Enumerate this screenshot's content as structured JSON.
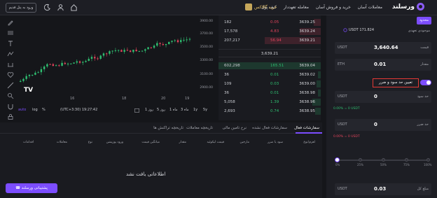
{
  "nav": {
    "brand": "ورسلند",
    "links": [
      "معاملات آسان",
      "خرید و فروش آسان",
      "معامله تعهددار",
      "کیف پول"
    ],
    "buy_link": "خرید گالاکس",
    "login_button": "ورود به پنل قدیم",
    "icons": [
      "home-icon",
      "user-icon",
      "moon-icon"
    ]
  },
  "chart": {
    "price_ticks": [
      "3900.00",
      "3700.00",
      "3500.00",
      "3300.00",
      "3100.00",
      "2900.00"
    ],
    "x_ticks": [
      "16",
      "18",
      "20",
      "19"
    ],
    "timezone": "(UTC+3:30) 19:27:42",
    "scale_labels": [
      "%",
      "log",
      "auto"
    ],
    "range_buttons": [
      "5y",
      "1y",
      "3m",
      "1m",
      "5d",
      "1d"
    ],
    "bottom_items": [
      "روز 1",
      "5 روز",
      "1 ماه",
      "3 ماه",
      "1y",
      "5y"
    ],
    "tv_logo": "TV",
    "colors": {
      "up": "#2fbf71",
      "down": "#e2445c"
    }
  },
  "orderbook": {
    "asks": [
      {
        "amount": "182",
        "total": "0.05",
        "price": "3639.25"
      },
      {
        "amount": "17,578",
        "total": "4.83",
        "price": "3639.24"
      },
      {
        "amount": "207,217",
        "total": "56.94",
        "price": "3639.21"
      }
    ],
    "mid_price": "3,639.21",
    "bids": [
      {
        "amount": "602,298",
        "total": "165.51",
        "price": "3639.04"
      },
      {
        "amount": "36",
        "total": "0.01",
        "price": "3639.02"
      },
      {
        "amount": "109",
        "total": "0.03",
        "price": "3639.00"
      },
      {
        "amount": "36",
        "total": "0.01",
        "price": "3638.98"
      },
      {
        "amount": "5,058",
        "total": "1.39",
        "price": "3638.96"
      },
      {
        "amount": "2,693",
        "total": "0.74",
        "price": "3638.95"
      }
    ]
  },
  "panel": {
    "tab_market": "محدود",
    "balance_label": "موجودی تعهدی",
    "balance_value": "USDT 171.824",
    "price": {
      "unit": "USDT",
      "value": "3,640.64",
      "name": "قیمت"
    },
    "amount": {
      "unit": "ETH",
      "value": "0.01",
      "name": "مقدار"
    },
    "tpsl_label": "تعیین حد سود و ضرر",
    "tp": {
      "unit": "USDT",
      "value": "0",
      "name": "حد سود"
    },
    "tp_info": "0.00% = 0 USDT",
    "sl": {
      "unit": "USDT",
      "value": "0",
      "name": "حد ضرر"
    },
    "sl_info": "0.00% = 0 USDT",
    "slider_labels": [
      "0%",
      "25%",
      "50%",
      "75%",
      "100%"
    ],
    "slider_value": 0,
    "size": {
      "unit": "USDT",
      "value": "0.03",
      "name": "مبلغ کل"
    }
  },
  "orders": {
    "tabs": [
      "سفارشات فعال",
      "سفارشات فعال نشده",
      "نرخ تامین مالی",
      "تاریخچه معاملات",
      "تاریخچه تراکنش ها"
    ],
    "columns": [
      "اهرم/نوع",
      "سود یا ضرر",
      "مارجین",
      "قیمت لیکوئید",
      "مقدار",
      "میانگین قیمت",
      "ورود پوزیشن",
      "نوع",
      "معاملات",
      "اقدامات"
    ],
    "empty_message": "اطلاعاتی یافت نشد",
    "support_button": "پشتیبانی ورسلند"
  }
}
